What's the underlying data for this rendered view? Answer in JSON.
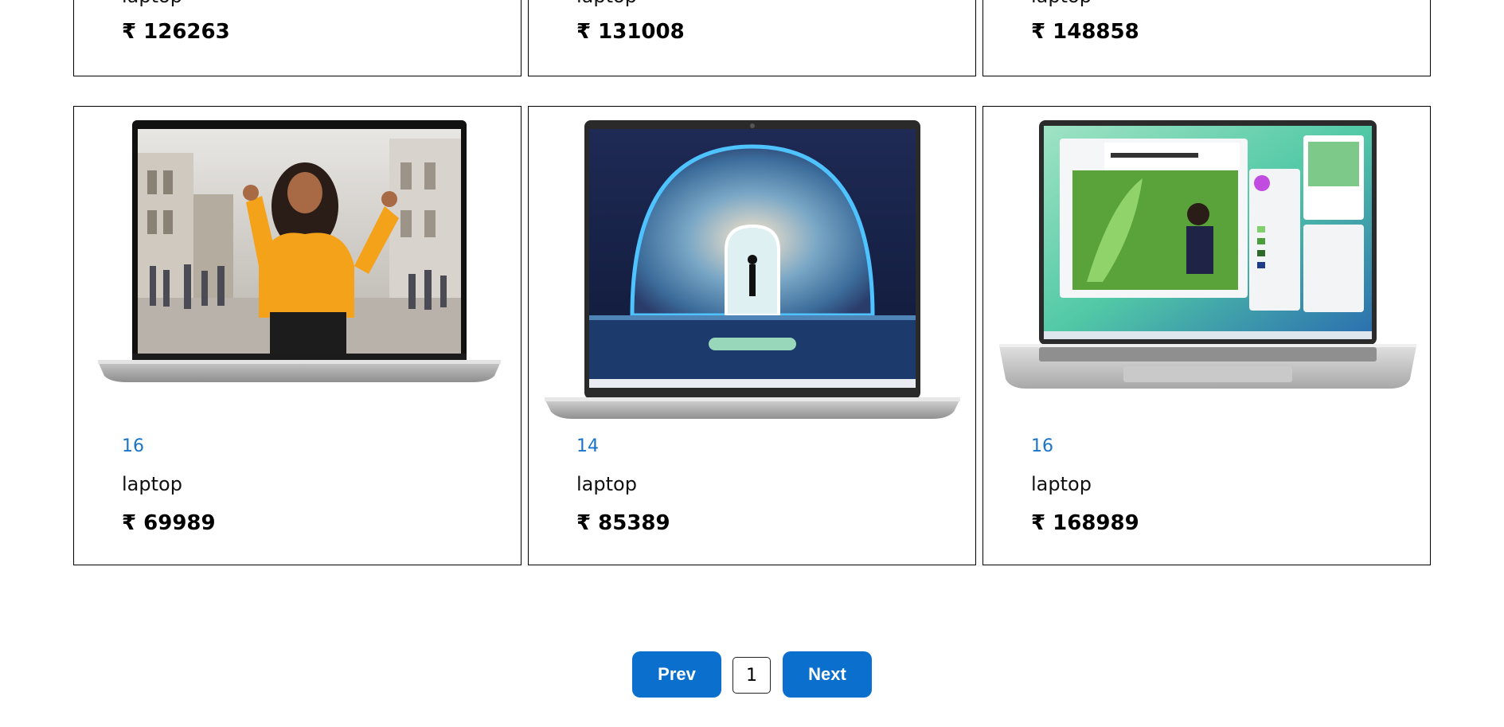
{
  "products_top": [
    {
      "category": "laptop",
      "price": "₹ 126263"
    },
    {
      "category": "laptop",
      "price": "₹ 131008"
    },
    {
      "category": "laptop",
      "price": "₹ 148858"
    }
  ],
  "products_bottom": [
    {
      "size": "16",
      "category": "laptop",
      "price": "₹ 69989",
      "image_icon": "laptop-photo-woman-dancing"
    },
    {
      "size": "14",
      "category": "laptop",
      "price": "₹ 85389",
      "image_icon": "laptop-photo-dome-wallpaper"
    },
    {
      "size": "16",
      "category": "laptop",
      "price": "₹ 168989",
      "image_icon": "laptop-photo-eco-fest-app"
    }
  ],
  "pagination": {
    "prev_label": "Prev",
    "current_page": "1",
    "next_label": "Next"
  },
  "colors": {
    "accent": "#0b6fce",
    "size_text": "#1a73c8",
    "border": "#000000"
  }
}
